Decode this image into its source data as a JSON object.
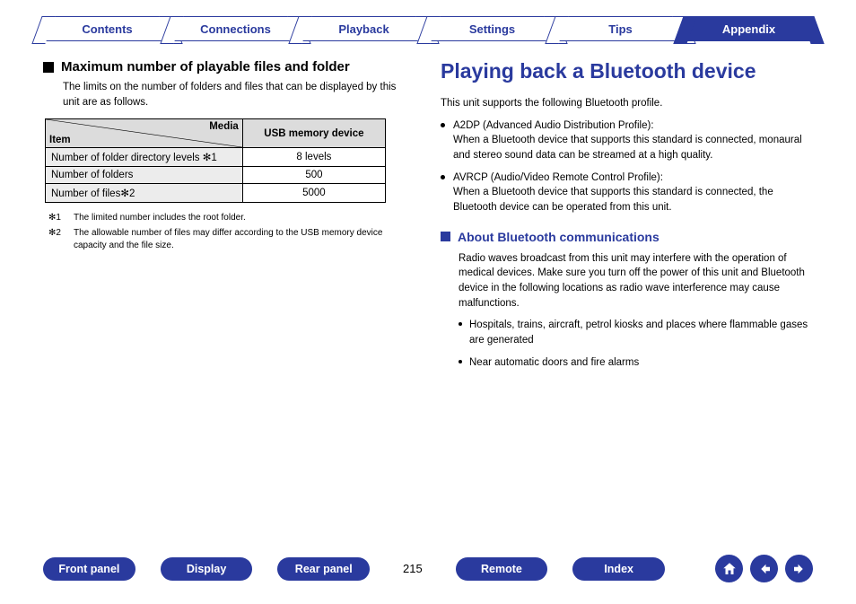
{
  "tabs": [
    {
      "label": "Contents",
      "active": false
    },
    {
      "label": "Connections",
      "active": false
    },
    {
      "label": "Playback",
      "active": false
    },
    {
      "label": "Settings",
      "active": false
    },
    {
      "label": "Tips",
      "active": false
    },
    {
      "label": "Appendix",
      "active": true
    }
  ],
  "left": {
    "heading": "Maximum number of playable files and folder",
    "intro": "The limits on the number of folders and files that can be displayed by this unit are as follows.",
    "table": {
      "corner_top": "Media",
      "corner_bottom": "Item",
      "col_header": "USB memory device",
      "rows": [
        {
          "label_pre": "Number of folder directory levels ",
          "sup": "1",
          "value": "8 levels"
        },
        {
          "label_pre": "Number of folders",
          "sup": "",
          "value": "500"
        },
        {
          "label_pre": "Number of files",
          "sup": "2",
          "value": "5000"
        }
      ]
    },
    "footnotes": [
      {
        "marker": "1",
        "text": "The limited number includes the root folder."
      },
      {
        "marker": "2",
        "text": "The allowable number of files may differ according to the USB memory device capacity and the file size."
      }
    ]
  },
  "right": {
    "title": "Playing back a Bluetooth device",
    "intro": "This unit supports the following Bluetooth profile.",
    "profiles": [
      {
        "name": "A2DP (Advanced Audio Distribution Profile):",
        "desc": "When a Bluetooth device that supports this standard is connected, monaural and stereo sound data can be streamed at a high quality."
      },
      {
        "name": "AVRCP (Audio/Video Remote Control Profile):",
        "desc": "When a Bluetooth device that supports this standard is connected, the Bluetooth device can be operated from this unit."
      }
    ],
    "sub": {
      "heading": "About Bluetooth communications",
      "intro": "Radio waves broadcast from this unit may interfere with the operation of medical devices. Make sure you turn off the power of this unit and Bluetooth device in the following locations as radio wave interference may cause malfunctions.",
      "items": [
        "Hospitals, trains, aircraft, petrol kiosks and places where flammable gases are generated",
        "Near automatic doors and fire alarms"
      ]
    }
  },
  "bottom": {
    "pills": [
      "Front panel",
      "Display",
      "Rear panel"
    ],
    "page": "215",
    "pills2": [
      "Remote",
      "Index"
    ]
  },
  "colors": {
    "primary": "#2a3a9e"
  }
}
